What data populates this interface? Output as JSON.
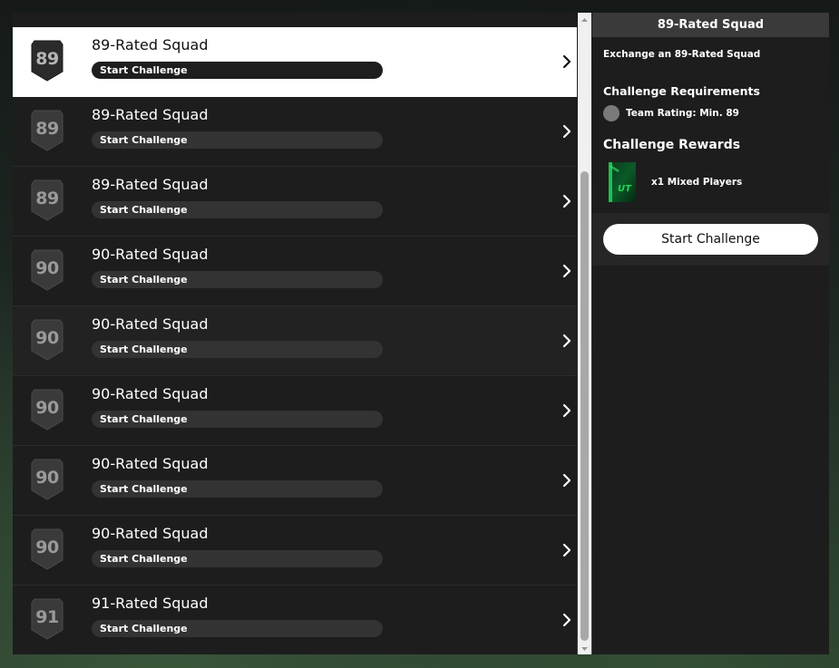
{
  "challenges": [
    {
      "rating": "89",
      "title": "89-Rated Squad",
      "action": "Start Challenge"
    },
    {
      "rating": "89",
      "title": "89-Rated Squad",
      "action": "Start Challenge"
    },
    {
      "rating": "89",
      "title": "89-Rated Squad",
      "action": "Start Challenge"
    },
    {
      "rating": "90",
      "title": "90-Rated Squad",
      "action": "Start Challenge"
    },
    {
      "rating": "90",
      "title": "90-Rated Squad",
      "action": "Start Challenge"
    },
    {
      "rating": "90",
      "title": "90-Rated Squad",
      "action": "Start Challenge"
    },
    {
      "rating": "90",
      "title": "90-Rated Squad",
      "action": "Start Challenge"
    },
    {
      "rating": "90",
      "title": "90-Rated Squad",
      "action": "Start Challenge"
    },
    {
      "rating": "91",
      "title": "91-Rated Squad",
      "action": "Start Challenge"
    }
  ],
  "selected_index": 0,
  "detail": {
    "header": "89-Rated Squad",
    "description": "Exchange an 89-Rated Squad",
    "requirements_title": "Challenge Requirements",
    "requirement": "Team Rating: Min. 89",
    "rewards_title": "Challenge Rewards",
    "reward": "x1 Mixed Players",
    "pack_label": "UT",
    "start_button": "Start Challenge"
  },
  "colors": {
    "panel": "#1d1d1d",
    "selected_row": "#ffffff",
    "pill": "#333333",
    "pack_green": "#1fd65a"
  }
}
